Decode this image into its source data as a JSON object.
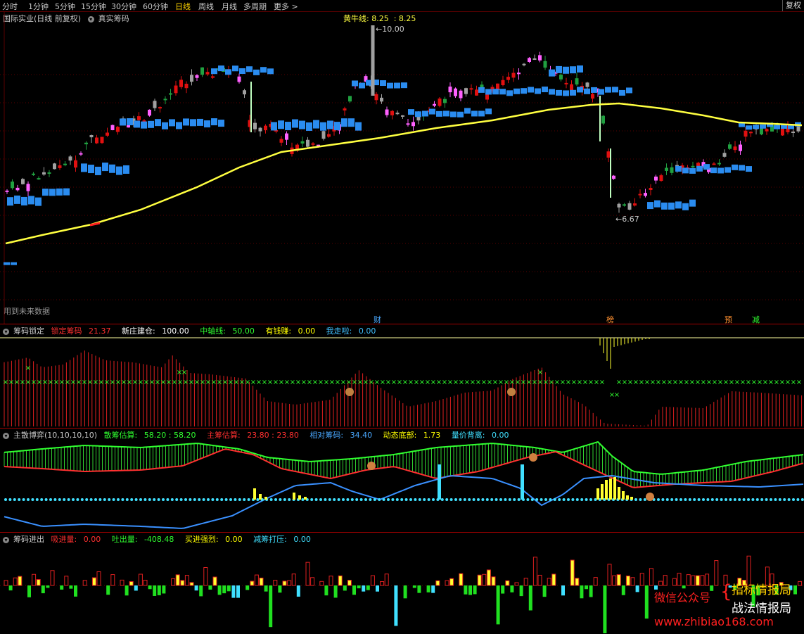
{
  "toolbar": {
    "items": [
      "分时",
      "1分钟",
      "5分钟",
      "15分钟",
      "30分钟",
      "60分钟",
      "日线",
      "周线",
      "月线",
      "多周期",
      "更多 >"
    ],
    "active_index": 6,
    "fuquan": "复权"
  },
  "main_panel": {
    "stock": "国际实业(日线 前复权)",
    "indicator": "真实筹码",
    "hline_label": "黄牛线: 8.25",
    "hline_value": ": 8.25",
    "high_label": "10.00",
    "low_label": "6.67",
    "future_note": "用到未来数据",
    "markers": [
      {
        "text": "财",
        "color": "#4aa8ff"
      },
      {
        "text": "榜",
        "color": "#ff9030"
      },
      {
        "text": "预",
        "color": "#ff9030"
      },
      {
        "text": "减",
        "color": "#30ff30"
      }
    ]
  },
  "panel_lock": {
    "title": "筹码锁定",
    "items": [
      {
        "label": "锁定筹码",
        "value": "21.37",
        "color": "#ff3030"
      },
      {
        "label": "新庄建仓:",
        "value": "100.00",
        "color": "#ffffff"
      },
      {
        "label": "中轴线:",
        "value": "50.00",
        "color": "#30ff30"
      },
      {
        "label": "有钱赚:",
        "value": "0.00",
        "color": "#ffff00"
      },
      {
        "label": "我走啦:",
        "value": "0.00",
        "color": "#40c0ff"
      }
    ]
  },
  "panel_game": {
    "title": "主散博弈(10,10,10,10)",
    "items": [
      {
        "label": "散筹估算:",
        "value": "58.20 : 58.20",
        "color": "#30ff30"
      },
      {
        "label": "主筹估算:",
        "value": "23.80 : 23.80",
        "color": "#ff3030"
      },
      {
        "label": "相对筹码:",
        "value": "34.40",
        "color": "#4aa8ff"
      },
      {
        "label": "动态底部:",
        "value": "1.73",
        "color": "#ffff00"
      },
      {
        "label": "量价背离:",
        "value": "0.00",
        "color": "#40e0ff"
      }
    ]
  },
  "panel_flow": {
    "title": "筹码进出",
    "items": [
      {
        "label": "吸进量:",
        "value": "0.00",
        "color": "#ff3030"
      },
      {
        "label": "吐出量:",
        "value": "-408.48",
        "color": "#30ff30"
      },
      {
        "label": "买进强烈:",
        "value": "0.00",
        "color": "#ffff00"
      },
      {
        "label": "减筹打压:",
        "value": "0.00",
        "color": "#40e0ff"
      }
    ]
  },
  "watermark": {
    "line1": "指标情报局",
    "line2": "微信公众号",
    "line3": "战法情报局",
    "line4": "www.zhibiao168.com"
  },
  "chart_data": {
    "type": "candlestick",
    "price_range": [
      6.67,
      10.0
    ],
    "yellow_line": "黄牛线",
    "yellow_line_last": 8.25,
    "lock_panel_range": [
      0,
      100
    ],
    "game_panel_range": [
      0,
      100
    ]
  }
}
